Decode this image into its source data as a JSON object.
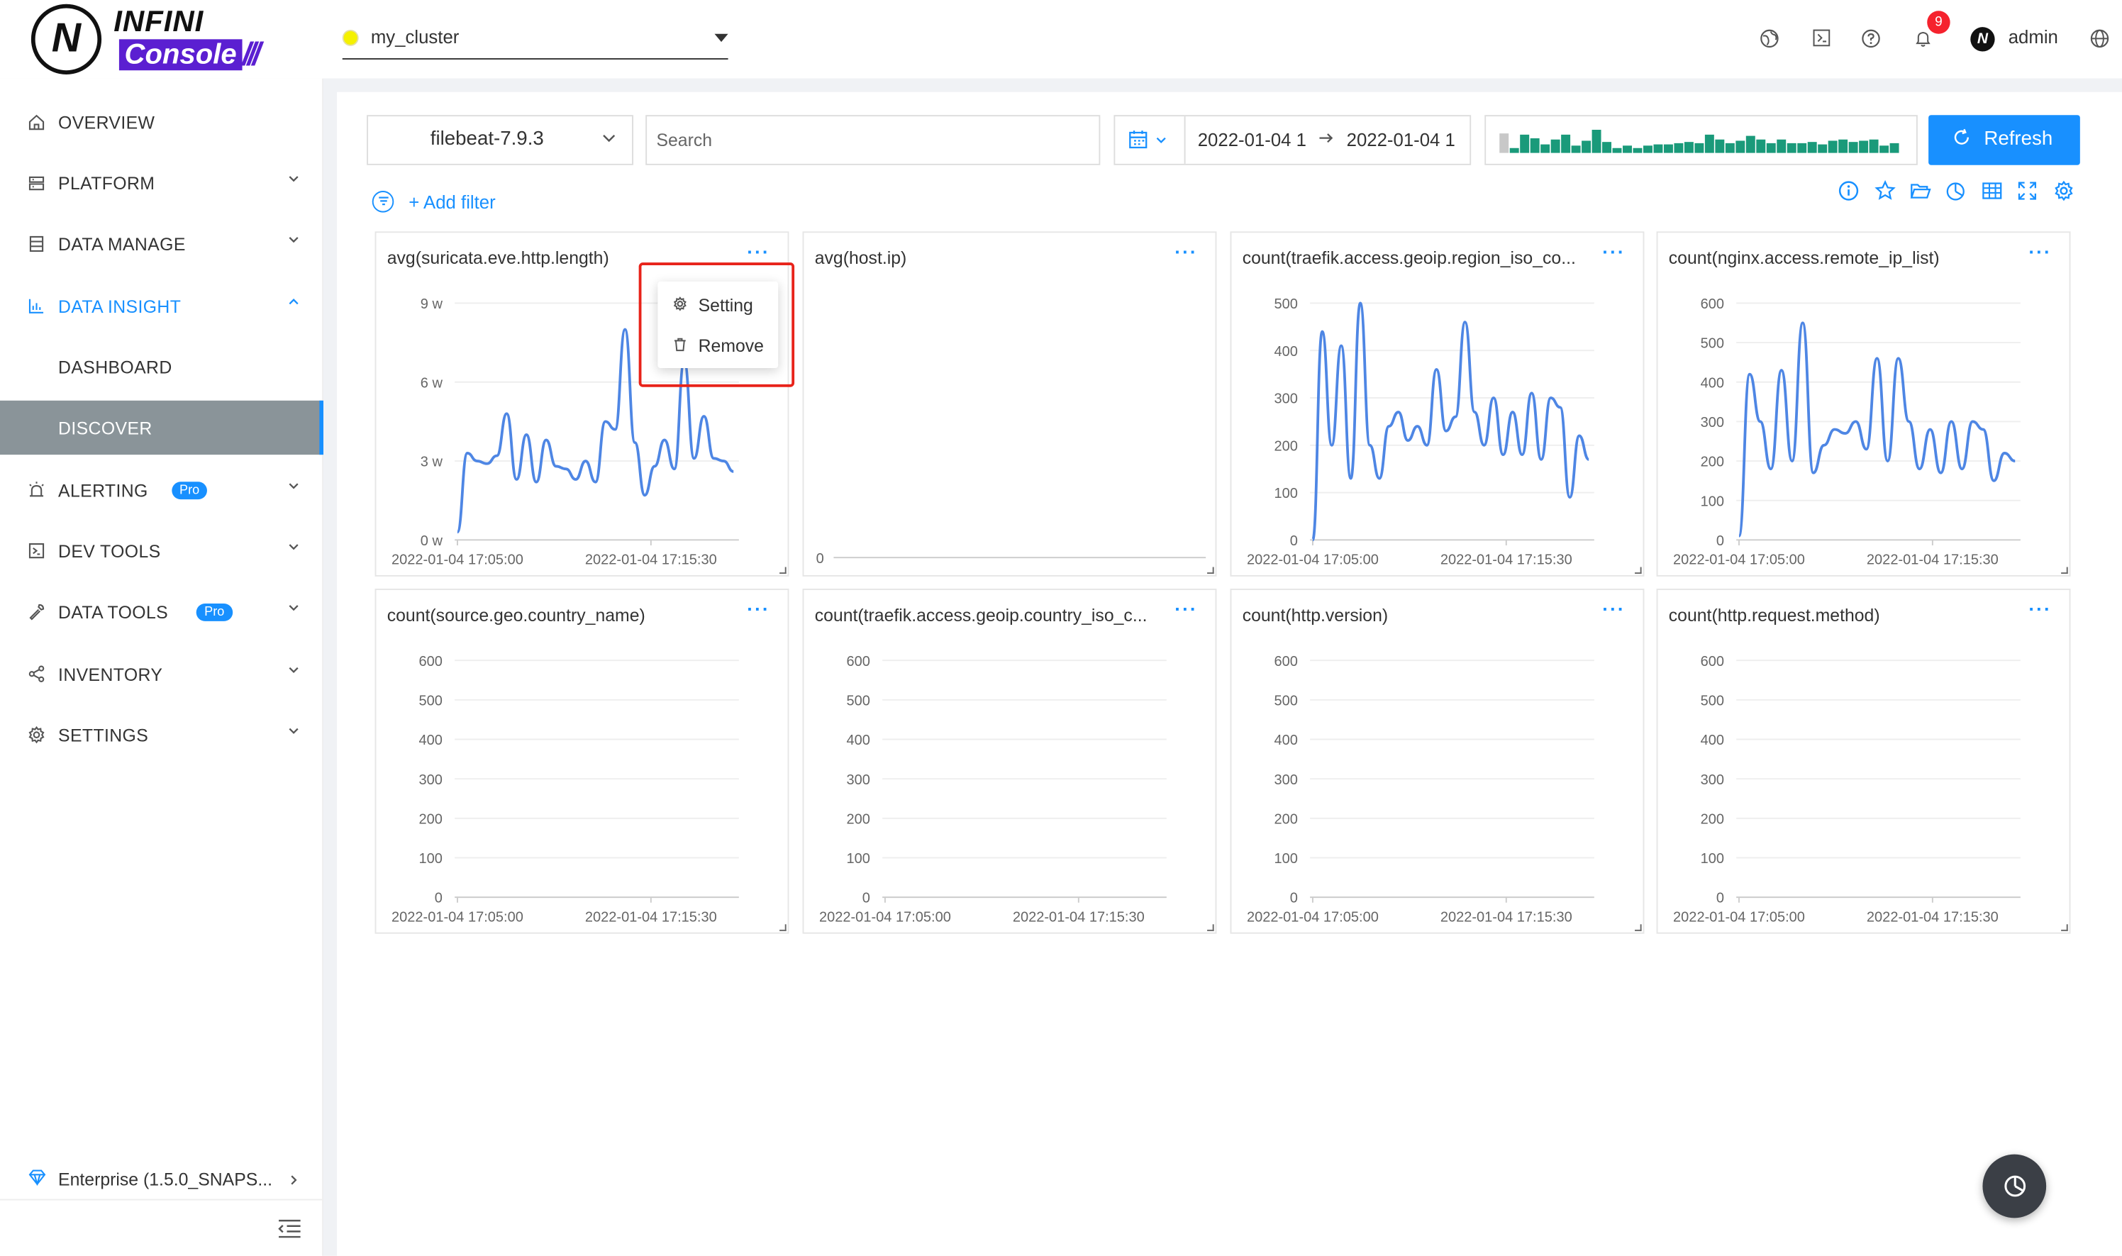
{
  "brand": {
    "logo_letter": "N",
    "logo_word": "INFINI",
    "logo_product": "Console",
    "logo_slashes": "///"
  },
  "cluster": {
    "name": "my_cluster",
    "status_color": "#f5f100"
  },
  "header": {
    "notification_count": "9",
    "user": "admin",
    "icons": [
      "earth-icon",
      "terminal-icon",
      "help-icon",
      "bell-icon",
      "globe-icon"
    ]
  },
  "sidebar": {
    "items": [
      {
        "label": "OVERVIEW",
        "icon": "home-icon",
        "expandable": false
      },
      {
        "label": "PLATFORM",
        "icon": "cluster-icon",
        "expandable": true
      },
      {
        "label": "DATA MANAGE",
        "icon": "database-icon",
        "expandable": true
      },
      {
        "label": "DATA INSIGHT",
        "icon": "chart-icon",
        "expandable": true,
        "expanded": true
      },
      {
        "label": "DASHBOARD",
        "icon": "",
        "expandable": false,
        "sub": true
      },
      {
        "label": "DISCOVER",
        "icon": "",
        "expandable": false,
        "sub": true,
        "selected": true
      },
      {
        "label": "ALERTING",
        "icon": "alarm-icon",
        "expandable": true,
        "badge": "Pro"
      },
      {
        "label": "DEV TOOLS",
        "icon": "code-icon",
        "expandable": true
      },
      {
        "label": "DATA TOOLS",
        "icon": "tool-icon",
        "expandable": true,
        "badge": "Pro"
      },
      {
        "label": "INVENTORY",
        "icon": "share-icon",
        "expandable": true
      },
      {
        "label": "SETTINGS",
        "icon": "gear-icon",
        "expandable": true
      }
    ],
    "enterprise": "Enterprise (1.5.0_SNAPS..."
  },
  "toolbar": {
    "index": "filebeat-7.9.3",
    "search_placeholder": "Search",
    "date_from": "2022-01-04 1",
    "date_to": "2022-01-04 1",
    "refresh_label": "Refresh",
    "add_filter": "+ Add filter",
    "histogram": [
      0.8,
      0.2,
      0.75,
      0.6,
      0.35,
      0.55,
      0.75,
      0.3,
      0.5,
      0.95,
      0.45,
      0.2,
      0.3,
      0.2,
      0.3,
      0.35,
      0.35,
      0.4,
      0.45,
      0.4,
      0.75,
      0.55,
      0.4,
      0.5,
      0.7,
      0.55,
      0.4,
      0.55,
      0.4,
      0.4,
      0.45,
      0.35,
      0.5,
      0.55,
      0.45,
      0.5,
      0.55,
      0.3,
      0.4
    ],
    "accent_color": "#1890ff",
    "histogram_color": "#1a9a7a"
  },
  "context_menu": {
    "setting": "Setting",
    "remove": "Remove"
  },
  "widgets": [
    {
      "title": "avg(suricata.eve.http.length)",
      "yticks": [
        "9 w",
        "6 w",
        "3 w",
        "0 w"
      ],
      "ymax": 9,
      "xticks": [
        "2022-01-04 17:05:00",
        "2022-01-04 17:15:30"
      ],
      "chart_data": {
        "type": "line",
        "xlabel": "",
        "ylabel": "",
        "ylim": [
          0,
          9
        ],
        "values": [
          0.3,
          3.3,
          3,
          2.9,
          3.2,
          4.8,
          2.3,
          4,
          2.2,
          3.8,
          2.8,
          2.7,
          2.3,
          3,
          2.2,
          4.5,
          4.2,
          8,
          3.7,
          1.7,
          2.8,
          3.8,
          2.7,
          6.8,
          3.1,
          4.7,
          3.1,
          3,
          2.6
        ]
      }
    },
    {
      "title": "avg(host.ip)",
      "yticks": [
        "0"
      ],
      "ymax": 1,
      "xticks": [],
      "chart_data": {
        "type": "line",
        "xlabel": "",
        "ylabel": "",
        "ylim": [
          0,
          1
        ],
        "values": []
      }
    },
    {
      "title": "count(traefik.access.geoip.region_iso_co...",
      "yticks": [
        "500",
        "400",
        "300",
        "200",
        "100",
        "0"
      ],
      "ymax": 500,
      "xticks": [
        "2022-01-04 17:05:00",
        "2022-01-04 17:15:30"
      ],
      "chart_data": {
        "type": "line",
        "xlabel": "",
        "ylabel": "",
        "ylim": [
          0,
          500
        ],
        "values": [
          0,
          440,
          200,
          410,
          130,
          500,
          200,
          130,
          240,
          270,
          210,
          240,
          200,
          360,
          230,
          260,
          460,
          270,
          200,
          300,
          180,
          270,
          180,
          310,
          170,
          300,
          280,
          90,
          220,
          170
        ]
      }
    },
    {
      "title": "count(nginx.access.remote_ip_list)",
      "yticks": [
        "600",
        "500",
        "400",
        "300",
        "200",
        "100",
        "0"
      ],
      "ymax": 600,
      "xticks": [
        "2022-01-04 17:05:00",
        "2022-01-04 17:15:30"
      ],
      "chart_data": {
        "type": "line",
        "xlabel": "",
        "ylabel": "",
        "ylim": [
          0,
          600
        ],
        "values": [
          10,
          420,
          300,
          180,
          430,
          200,
          550,
          170,
          240,
          280,
          270,
          300,
          230,
          460,
          200,
          460,
          300,
          180,
          280,
          170,
          300,
          180,
          300,
          280,
          150,
          220,
          200
        ]
      }
    },
    {
      "title": "count(source.geo.country_name)",
      "yticks": [
        "600",
        "500",
        "400",
        "300",
        "200",
        "100",
        "0"
      ],
      "ymax": 600,
      "xticks": [
        "2022-01-04 17:05:00",
        "2022-01-04 17:15:30"
      ],
      "chart_data": {
        "type": "line",
        "xlabel": "",
        "ylabel": "",
        "ylim": [
          0,
          600
        ],
        "values": []
      }
    },
    {
      "title": "count(traefik.access.geoip.country_iso_c...",
      "yticks": [
        "600",
        "500",
        "400",
        "300",
        "200",
        "100",
        "0"
      ],
      "ymax": 600,
      "xticks": [
        "2022-01-04 17:05:00",
        "2022-01-04 17:15:30"
      ],
      "chart_data": {
        "type": "line",
        "xlabel": "",
        "ylabel": "",
        "ylim": [
          0,
          600
        ],
        "values": []
      }
    },
    {
      "title": "count(http.version)",
      "yticks": [
        "600",
        "500",
        "400",
        "300",
        "200",
        "100",
        "0"
      ],
      "ymax": 600,
      "xticks": [
        "2022-01-04 17:05:00",
        "2022-01-04 17:15:30"
      ],
      "chart_data": {
        "type": "line",
        "xlabel": "",
        "ylabel": "",
        "ylim": [
          0,
          600
        ],
        "values": []
      }
    },
    {
      "title": "count(http.request.method)",
      "yticks": [
        "600",
        "500",
        "400",
        "300",
        "200",
        "100",
        "0"
      ],
      "ymax": 600,
      "xticks": [
        "2022-01-04 17:05:00",
        "2022-01-04 17:15:30"
      ],
      "chart_data": {
        "type": "line",
        "xlabel": "",
        "ylabel": "",
        "ylim": [
          0,
          600
        ],
        "values": []
      }
    }
  ],
  "line_color": "#4e86e4"
}
